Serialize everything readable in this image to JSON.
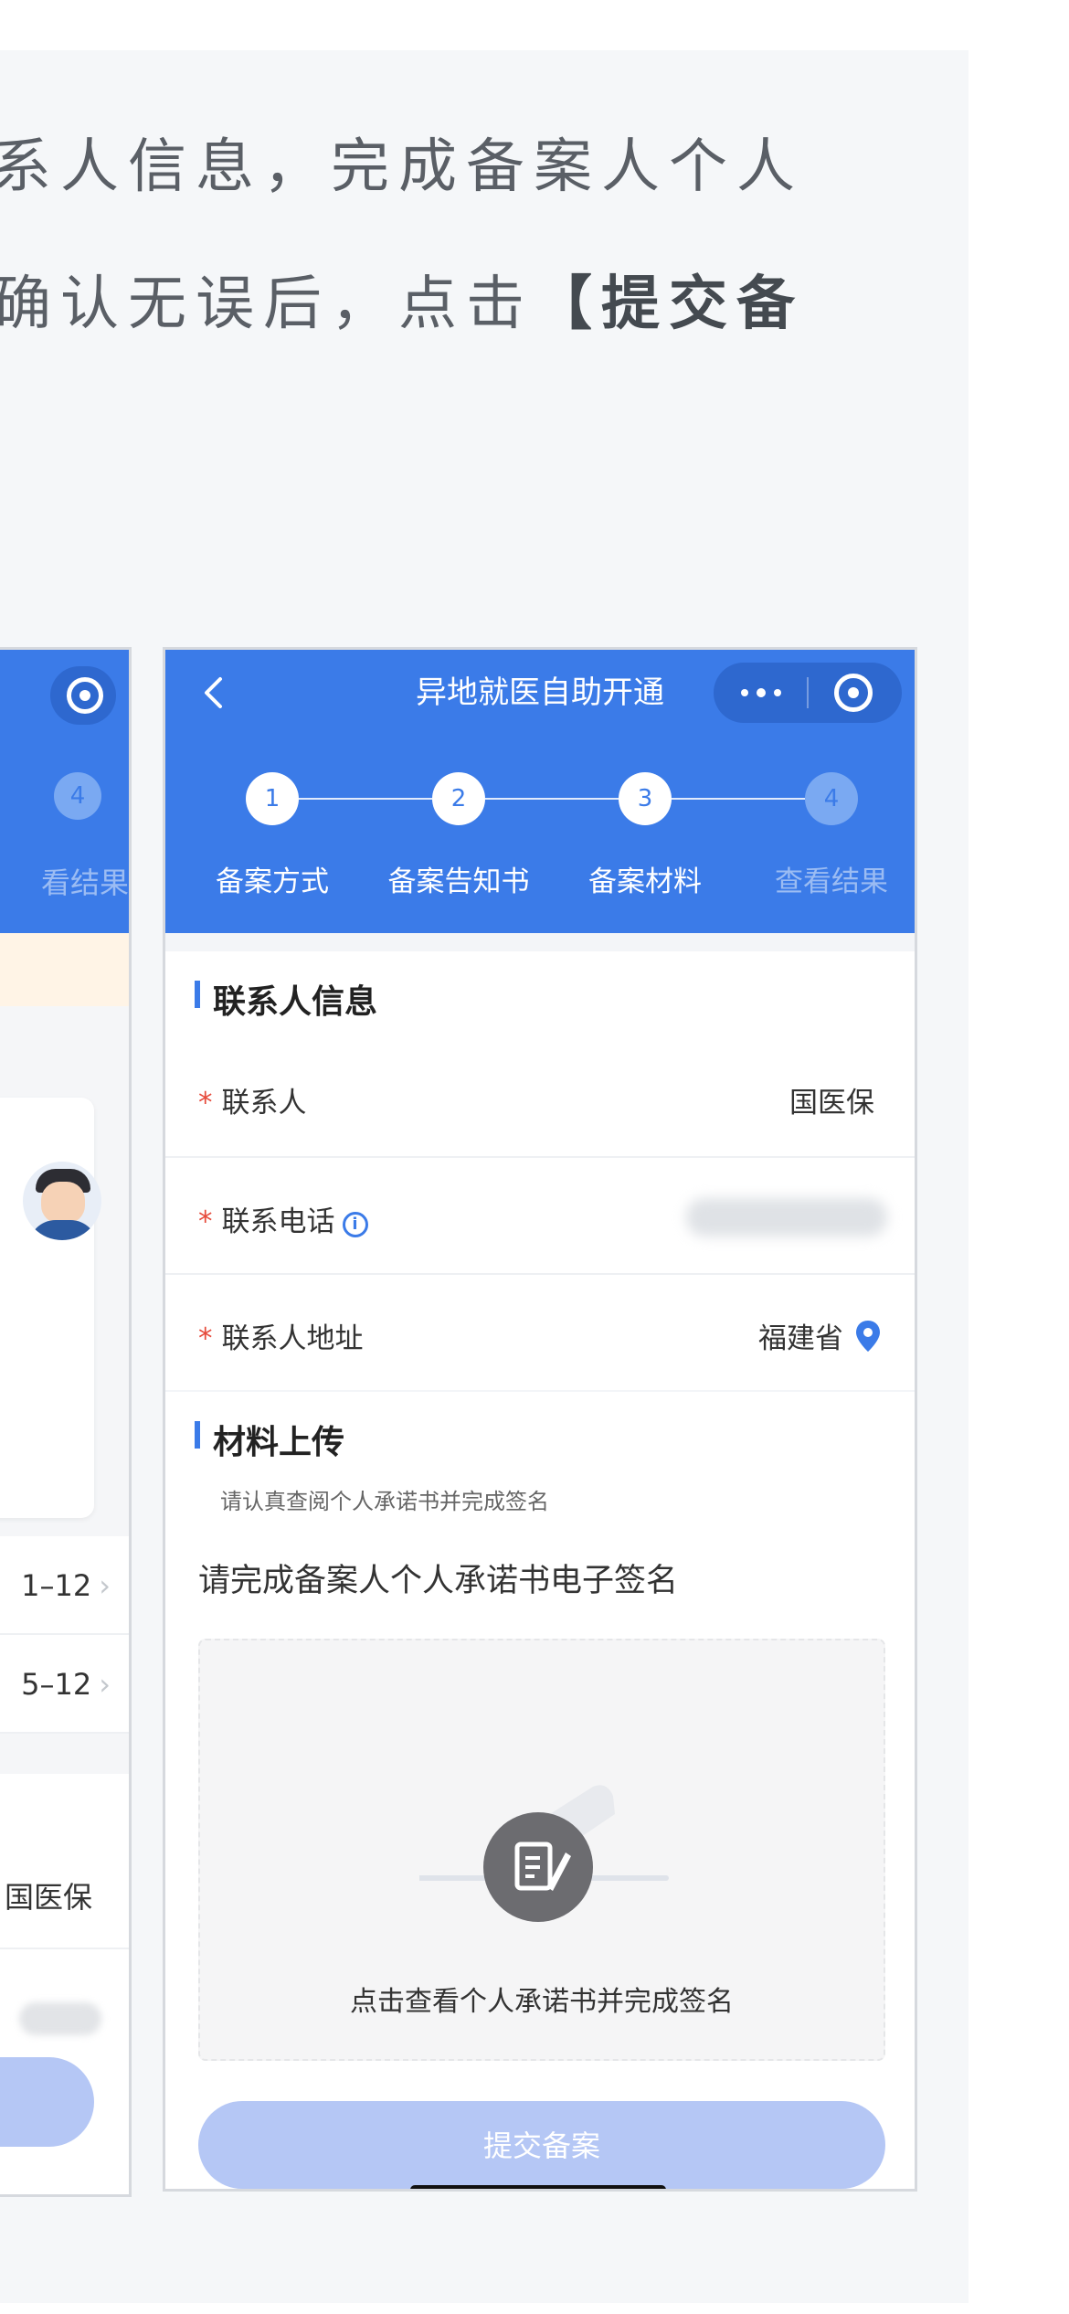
{
  "article": {
    "line1": "系人信息，完成备案人个人",
    "line2_normal": "确认无误后，点击",
    "line2_bold": "【提交备"
  },
  "left_phone": {
    "step4": "4",
    "step4_label": "看结果",
    "row1_value": "1–12",
    "row2_value": "5–12",
    "contact_name": "国医保"
  },
  "phone": {
    "nav": {
      "title": "异地就医自助开通"
    },
    "steps": [
      {
        "num": "1",
        "label": "备案方式",
        "active": true
      },
      {
        "num": "2",
        "label": "备案告知书",
        "active": true
      },
      {
        "num": "3",
        "label": "备案材料",
        "active": true
      },
      {
        "num": "4",
        "label": "查看结果",
        "active": false
      }
    ],
    "contact_section": {
      "title": "联系人信息",
      "fields": [
        {
          "label": "联系人",
          "value": "国医保"
        },
        {
          "label": "联系电话",
          "value": ""
        },
        {
          "label": "联系人地址",
          "value": "福建省"
        }
      ]
    },
    "upload_section": {
      "title": "材料上传",
      "hint": "请认真查阅个人承诺书并完成签名",
      "sign_title": "请完成备案人个人承诺书电子签名",
      "sign_caption": "点击查看个人承诺书并完成签名"
    },
    "submit_label": "提交备案",
    "colors": {
      "primary": "#3b7be8",
      "button_disabled": "#b5c7f5",
      "required": "#e64a3b"
    }
  }
}
